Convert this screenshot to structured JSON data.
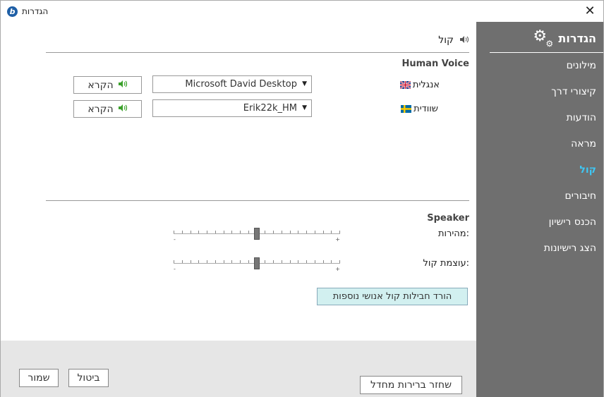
{
  "window": {
    "title": "הגדרות",
    "close_glyph": "✕"
  },
  "sidebar": {
    "title": "הגדרות",
    "items": [
      {
        "label": "מילונים",
        "active": false
      },
      {
        "label": "קיצורי דרך",
        "active": false
      },
      {
        "label": "הודעות",
        "active": false
      },
      {
        "label": "מראה",
        "active": false
      },
      {
        "label": "קול",
        "active": true
      },
      {
        "label": "חיבורים",
        "active": false
      },
      {
        "label": "הכנס רישיון",
        "active": false
      },
      {
        "label": "הצג רישיונות",
        "active": false
      }
    ]
  },
  "content": {
    "section_title": "קול",
    "human_voice": {
      "heading": "Human Voice",
      "rows": [
        {
          "language": "אנגלית",
          "flag": "uk-flag-icon",
          "voice": "Microsoft David Desktop",
          "play_label": "הקרא"
        },
        {
          "language": "שוודית",
          "flag": "sweden-flag-icon",
          "voice": "Erik22k_HM",
          "play_label": "הקרא"
        }
      ]
    },
    "speaker": {
      "heading": "Speaker",
      "speed": {
        "label": "מהירות:",
        "value_fraction": 0.5,
        "min_symbol": "-",
        "max_symbol": "+"
      },
      "volume": {
        "label": "עוצמת קול:",
        "value_fraction": 0.5,
        "min_symbol": "-",
        "max_symbol": "+"
      }
    },
    "download_button": "הורד חבילות קול אנושי נוספות"
  },
  "footer": {
    "restore_defaults": "שחזר ברירות מחדל",
    "cancel": "ביטול",
    "save": "שמור"
  },
  "colors": {
    "sidebar_bg": "#6f6f6f",
    "active_item": "#3fc6f3",
    "download_button_bg": "#d2f0f0",
    "play_icon": "#3aa02a"
  }
}
